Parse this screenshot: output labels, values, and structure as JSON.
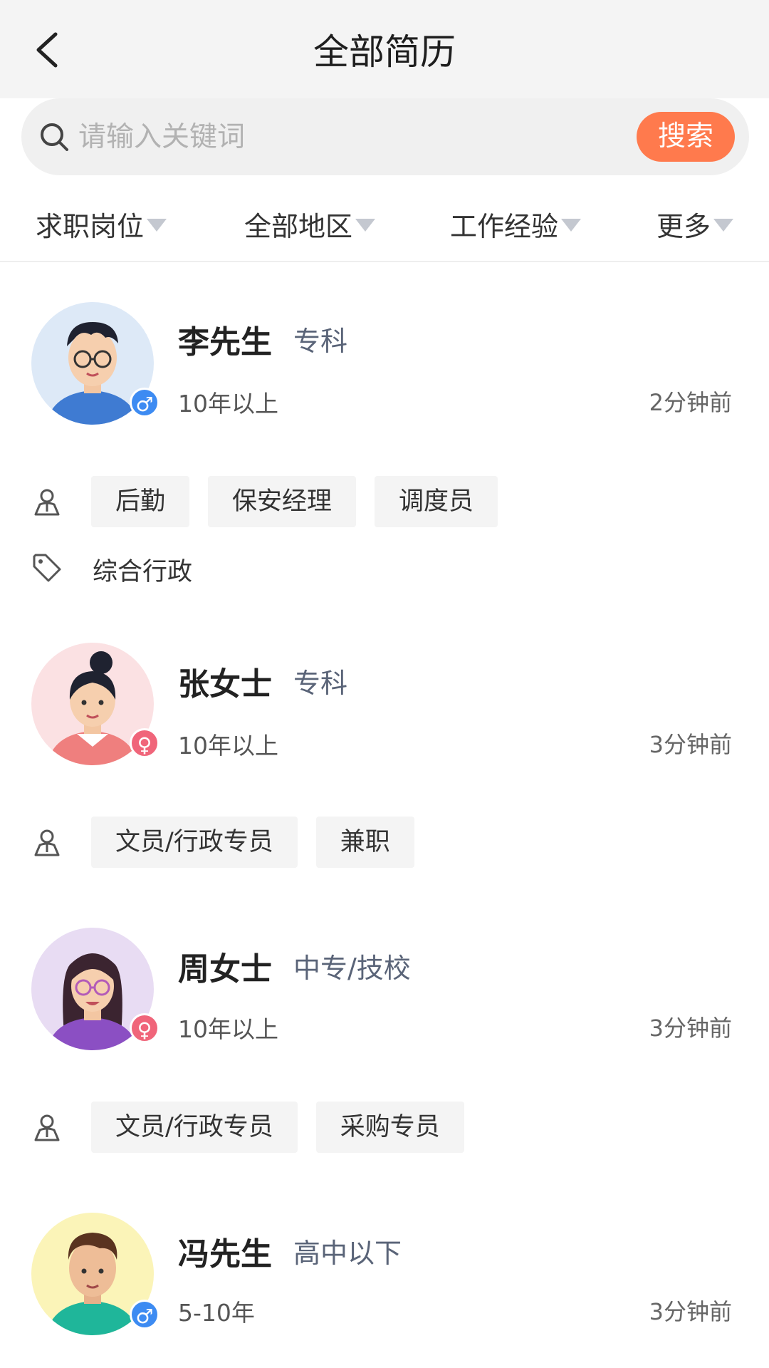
{
  "header": {
    "title": "全部简历",
    "back_icon": "chevron-left-icon"
  },
  "search": {
    "placeholder": "请输入关键词",
    "button_label": "搜索",
    "accent_color": "#ff7a4d"
  },
  "filters": [
    {
      "label": "求职岗位"
    },
    {
      "label": "全部地区"
    },
    {
      "label": "工作经验"
    },
    {
      "label": "更多"
    }
  ],
  "resumes": [
    {
      "name": "李先生",
      "education": "专科",
      "experience": "10年以上",
      "time": "2分钟前",
      "gender": "male",
      "gender_symbol": "♂",
      "positions": [
        "后勤",
        "保安经理",
        "调度员"
      ],
      "keyword": "综合行政"
    },
    {
      "name": "张女士",
      "education": "专科",
      "experience": "10年以上",
      "time": "3分钟前",
      "gender": "female",
      "gender_symbol": "♀",
      "positions": [
        "文员/行政专员",
        "兼职"
      ]
    },
    {
      "name": "周女士",
      "education": "中专/技校",
      "experience": "10年以上",
      "time": "3分钟前",
      "gender": "female",
      "gender_symbol": "♀",
      "positions": [
        "文员/行政专员",
        "采购专员"
      ]
    },
    {
      "name": "冯先生",
      "education": "高中以下",
      "experience": "5-10年",
      "time": "3分钟前",
      "gender": "male",
      "gender_symbol": "♂"
    }
  ]
}
